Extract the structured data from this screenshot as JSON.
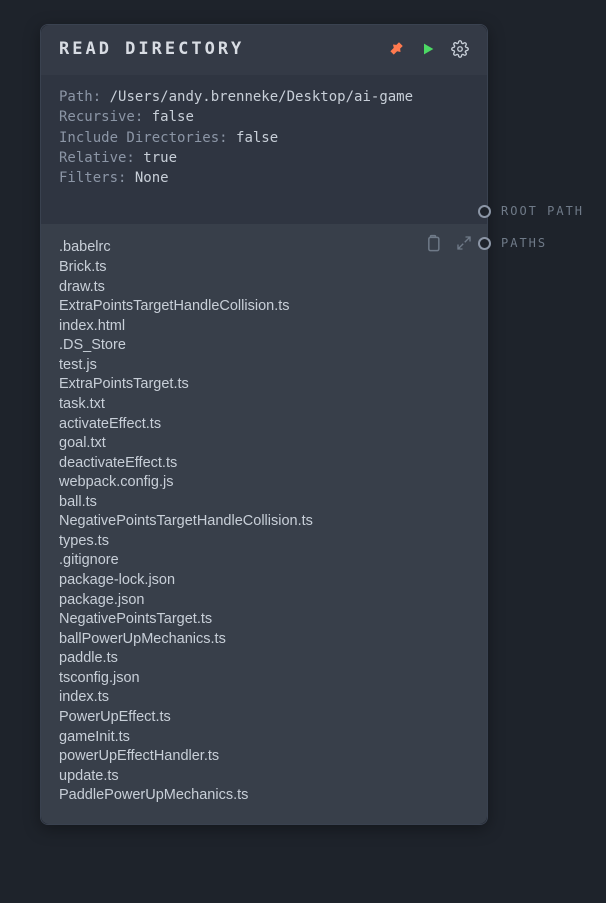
{
  "colors": {
    "accent": "#4cd964",
    "pin": "#ff7a4f",
    "bg": "#1e232b"
  },
  "icons": {
    "pin": "pin-icon",
    "run": "play-icon",
    "settings": "gear-icon",
    "copy": "clipboard-icon",
    "expand": "expand-icon"
  },
  "node": {
    "title": "READ DIRECTORY",
    "meta": {
      "path_key": "Path:",
      "path_val": "/Users/andy.brenneke/Desktop/ai-game",
      "recursive_key": "Recursive:",
      "recursive_val": "false",
      "include_dirs_key": "Include Directories:",
      "include_dirs_val": "false",
      "relative_key": "Relative:",
      "relative_val": "true",
      "filters_key": "Filters:",
      "filters_val": "None"
    },
    "ports": [
      {
        "label": "ROOT PATH"
      },
      {
        "label": "PATHS"
      }
    ],
    "files": [
      ".babelrc",
      "Brick.ts",
      "draw.ts",
      "ExtraPointsTargetHandleCollision.ts",
      "index.html",
      ".DS_Store",
      "test.js",
      "ExtraPointsTarget.ts",
      "task.txt",
      "activateEffect.ts",
      "goal.txt",
      "deactivateEffect.ts",
      "webpack.config.js",
      "ball.ts",
      "NegativePointsTargetHandleCollision.ts",
      "types.ts",
      ".gitignore",
      "package-lock.json",
      "package.json",
      "NegativePointsTarget.ts",
      "ballPowerUpMechanics.ts",
      "paddle.ts",
      "tsconfig.json",
      "index.ts",
      "PowerUpEffect.ts",
      "gameInit.ts",
      "powerUpEffectHandler.ts",
      "update.ts",
      "PaddlePowerUpMechanics.ts"
    ]
  }
}
